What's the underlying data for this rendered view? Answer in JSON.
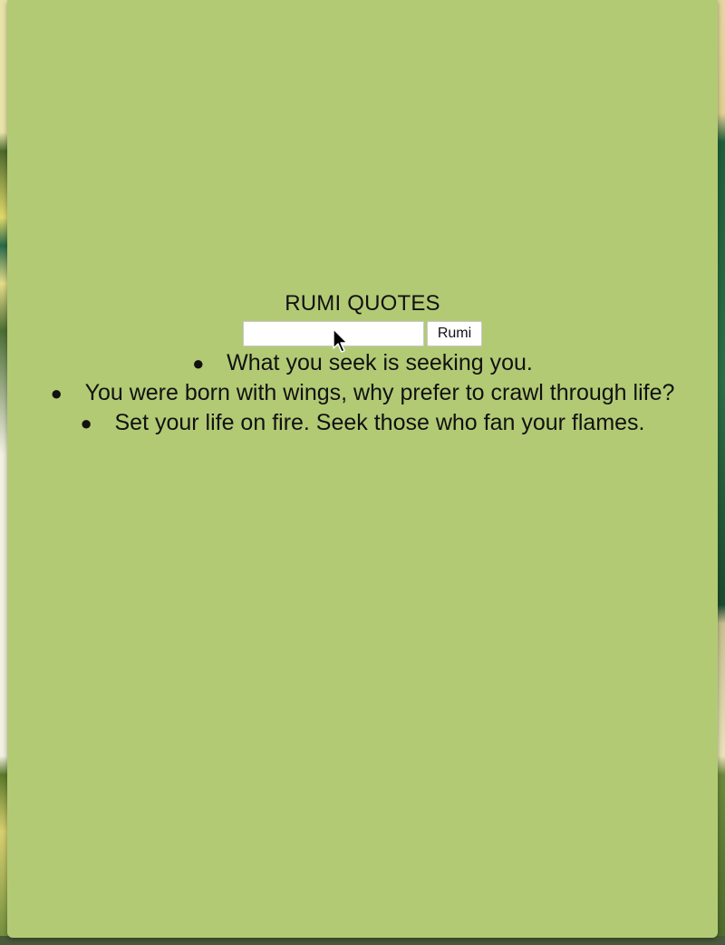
{
  "page": {
    "title": "RUMI QUOTES"
  },
  "form": {
    "input_value": "",
    "button_label": "Rumi"
  },
  "quotes": [
    "What you seek is seeking you.",
    "You were born with wings, why prefer to crawl through life?",
    "Set your life on fire. Seek those who fan your flames."
  ],
  "colors": {
    "window_background": "#b3ca75",
    "text": "#111111"
  },
  "icons": {
    "cursor": "mouse-pointer-icon",
    "bullet": "bullet-icon"
  }
}
